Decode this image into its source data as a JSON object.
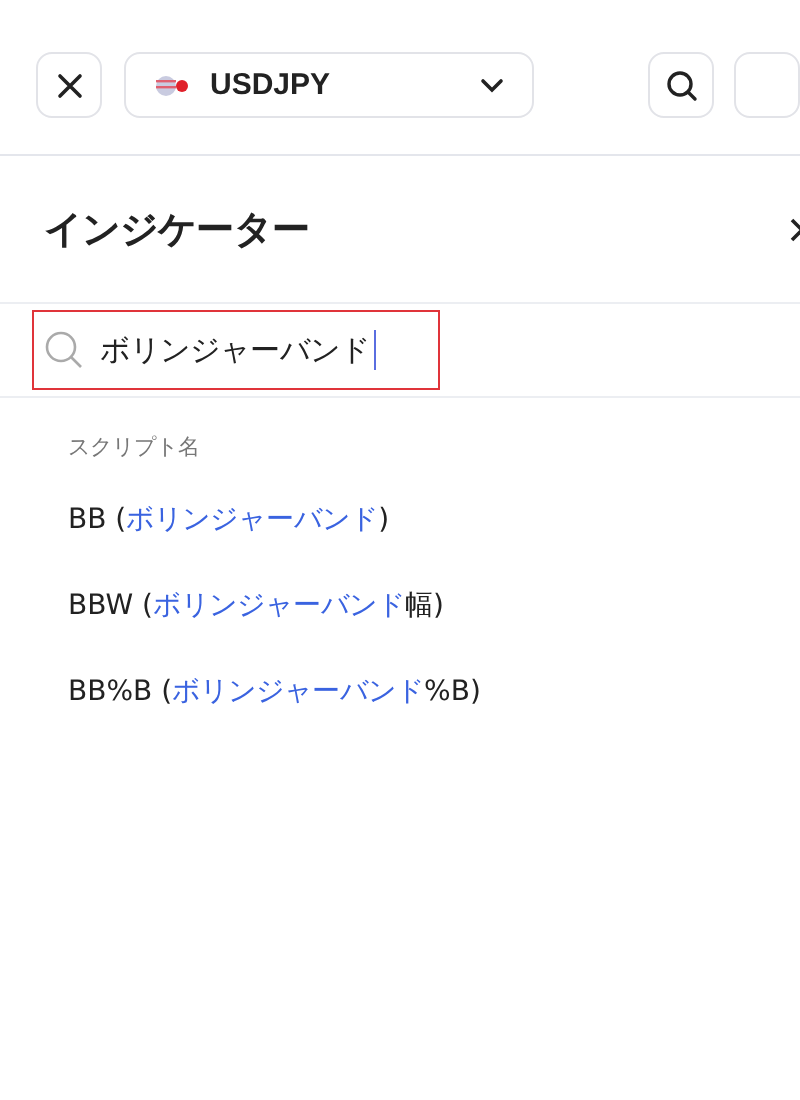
{
  "toolbar": {
    "symbol": "USDJPY"
  },
  "panel": {
    "title": "インジケーター",
    "search": {
      "value": "ボリンジャーバンド",
      "focused": true
    },
    "section_label": "スクリプト名",
    "results": [
      {
        "segments": [
          {
            "text": "BB (",
            "highlight": false
          },
          {
            "text": "ボリンジャーバンド",
            "highlight": true
          },
          {
            "text": ")",
            "highlight": false
          }
        ]
      },
      {
        "segments": [
          {
            "text": "BBW (",
            "highlight": false
          },
          {
            "text": "ボリンジャーバンド",
            "highlight": true
          },
          {
            "text": "幅)",
            "highlight": false
          }
        ]
      },
      {
        "segments": [
          {
            "text": "BB%B (",
            "highlight": false
          },
          {
            "text": "ボリンジャーバンド",
            "highlight": true
          },
          {
            "text": "%B)",
            "highlight": false
          }
        ]
      }
    ]
  }
}
